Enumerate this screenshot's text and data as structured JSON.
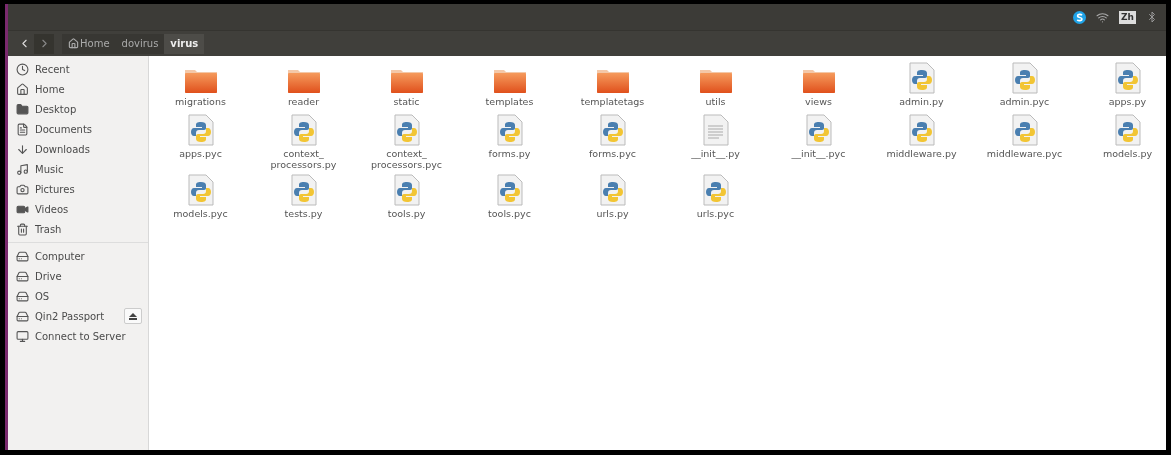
{
  "top_panel": {
    "tray": [
      {
        "kind": "skype"
      },
      {
        "kind": "wifi"
      },
      {
        "kind": "text",
        "label": "Zh"
      },
      {
        "kind": "bluetooth"
      }
    ]
  },
  "toolbar": {
    "breadcrumbs": [
      {
        "label": "Home",
        "home": true,
        "selected": false
      },
      {
        "label": "dovirus",
        "home": false,
        "selected": false
      },
      {
        "label": "virus",
        "home": false,
        "selected": true
      }
    ]
  },
  "sidebar": {
    "sections": [
      {
        "items": [
          {
            "label": "Recent",
            "kind": "clock"
          },
          {
            "label": "Home",
            "kind": "home"
          },
          {
            "label": "Desktop",
            "kind": "folder"
          },
          {
            "label": "Documents",
            "kind": "document"
          },
          {
            "label": "Downloads",
            "kind": "download"
          },
          {
            "label": "Music",
            "kind": "music"
          },
          {
            "label": "Pictures",
            "kind": "camera"
          },
          {
            "label": "Videos",
            "kind": "video"
          },
          {
            "label": "Trash",
            "kind": "trash"
          }
        ]
      },
      {
        "items": [
          {
            "label": "Computer",
            "kind": "drive",
            "eject": false
          },
          {
            "label": "Drive",
            "kind": "drive",
            "eject": false
          },
          {
            "label": "OS",
            "kind": "drive",
            "eject": false
          },
          {
            "label": "Qin2 Passport",
            "kind": "drive",
            "eject": true
          },
          {
            "label": "Connect to Server",
            "kind": "server",
            "eject": false
          }
        ]
      }
    ]
  },
  "files": [
    {
      "name": "migrations",
      "kind": "folder"
    },
    {
      "name": "reader",
      "kind": "folder"
    },
    {
      "name": "static",
      "kind": "folder"
    },
    {
      "name": "templates",
      "kind": "folder"
    },
    {
      "name": "templatetags",
      "kind": "folder"
    },
    {
      "name": "utils",
      "kind": "folder"
    },
    {
      "name": "views",
      "kind": "folder"
    },
    {
      "name": "admin.py",
      "kind": "python"
    },
    {
      "name": "admin.pyc",
      "kind": "python"
    },
    {
      "name": "apps.py",
      "kind": "python"
    },
    {
      "name": "apps.pyc",
      "kind": "python"
    },
    {
      "name": "context_ processors.py",
      "kind": "python"
    },
    {
      "name": "context_ processors.pyc",
      "kind": "python"
    },
    {
      "name": "forms.py",
      "kind": "python"
    },
    {
      "name": "forms.pyc",
      "kind": "python"
    },
    {
      "name": "__init__.py",
      "kind": "text"
    },
    {
      "name": "__init__.pyc",
      "kind": "python"
    },
    {
      "name": "middleware.py",
      "kind": "python"
    },
    {
      "name": "middleware.pyc",
      "kind": "python"
    },
    {
      "name": "models.py",
      "kind": "python"
    },
    {
      "name": "models.pyc",
      "kind": "python"
    },
    {
      "name": "tests.py",
      "kind": "python"
    },
    {
      "name": "tools.py",
      "kind": "python"
    },
    {
      "name": "tools.pyc",
      "kind": "python"
    },
    {
      "name": "urls.py",
      "kind": "python"
    },
    {
      "name": "urls.pyc",
      "kind": "python"
    }
  ]
}
